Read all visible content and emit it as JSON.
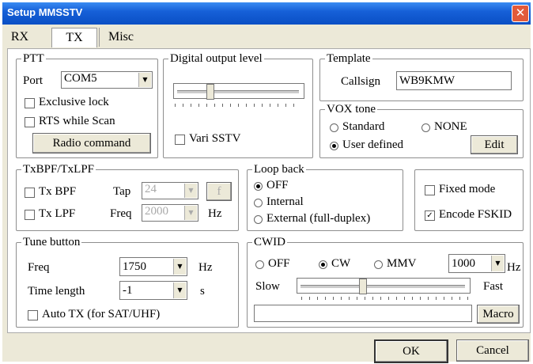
{
  "window": {
    "title": "Setup MMSSTV",
    "close_glyph": "✕"
  },
  "tabs": [
    {
      "label": "RX"
    },
    {
      "label": "TX"
    },
    {
      "label": "Misc"
    }
  ],
  "ptt": {
    "legend": "PTT",
    "port_label": "Port",
    "port_value": "COM5",
    "exclusive_lock": "Exclusive lock",
    "rts_while_scan": "RTS while Scan",
    "radio_command": "Radio command"
  },
  "digital": {
    "legend": "Digital output level",
    "vari_sstv": "Vari SSTV",
    "level": 0.25
  },
  "template": {
    "legend": "Template",
    "callsign_label": "Callsign",
    "callsign_value": "WB9KMW"
  },
  "vox": {
    "legend": "VOX tone",
    "standard": "Standard",
    "none": "NONE",
    "user_defined": "User defined",
    "edit": "Edit"
  },
  "txbpf": {
    "legend": "TxBPF/TxLPF",
    "tx_bpf": "Tx BPF",
    "tap_label": "Tap",
    "tap_value": "24",
    "f_button": "f",
    "tx_lpf": "Tx LPF",
    "freq_label": "Freq",
    "freq_value": "2000",
    "hz": "Hz"
  },
  "loopback": {
    "legend": "Loop back",
    "off": "OFF",
    "internal": "Internal",
    "external": "External (full-duplex)"
  },
  "modes": {
    "fixed_mode": "Fixed mode",
    "encode_fskid": "Encode FSKID"
  },
  "tune": {
    "legend": "Tune button",
    "freq_label": "Freq",
    "freq_value": "1750",
    "hz": "Hz",
    "time_label": "Time length",
    "time_value": "-1",
    "s": "s",
    "auto_tx": "Auto TX (for SAT/UHF)"
  },
  "cwid": {
    "legend": "CWID",
    "off": "OFF",
    "cw": "CW",
    "mmv": "MMV",
    "speed_value": "1000",
    "hz": "Hz",
    "slow": "Slow",
    "fast": "Fast",
    "macro": "Macro",
    "text_value": "",
    "speed_level": 0.37
  },
  "footer": {
    "ok": "OK",
    "cancel": "Cancel"
  },
  "icons": {
    "check": "✓",
    "arrow_down": "▼"
  }
}
